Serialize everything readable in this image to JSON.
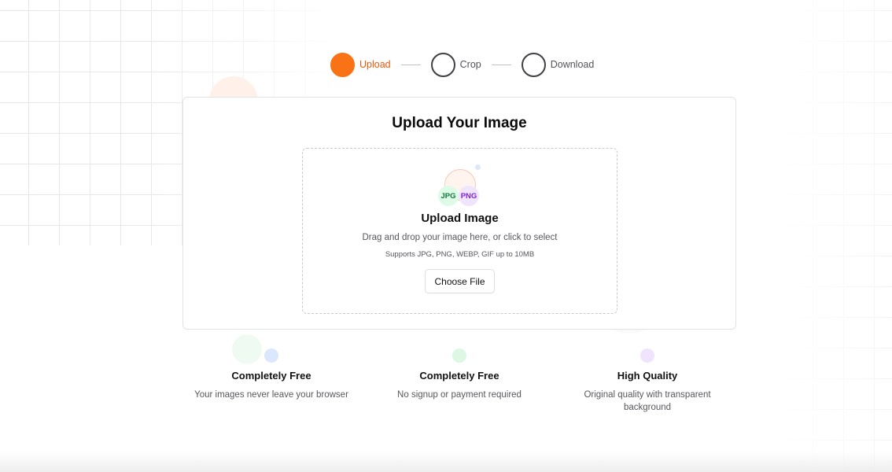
{
  "stepper": {
    "steps": [
      {
        "label": "Upload",
        "state": "active"
      },
      {
        "label": "Crop",
        "state": "inactive"
      },
      {
        "label": "Download",
        "state": "inactive"
      }
    ],
    "accent_color": "#f97316"
  },
  "upload_card": {
    "title": "Upload Your Image",
    "dropzone": {
      "badges": [
        "JPG",
        "PNG"
      ],
      "title": "Upload Image",
      "subtitle": "Drag and drop your image here, or click to select",
      "formats_note": "Supports JPG, PNG, WEBP, GIF up to 10MB",
      "button_label": "Choose File",
      "icon": "upload-image-icon"
    }
  },
  "features": [
    {
      "title": "Completely Free",
      "description": "Your images never leave your browser",
      "icon": "blue-dot-icon"
    },
    {
      "title": "Completely Free",
      "description": "No signup or payment required",
      "icon": "green-dot-icon"
    },
    {
      "title": "High Quality",
      "description": "Original quality with transparent background",
      "icon": "purple-dot-icon"
    }
  ]
}
